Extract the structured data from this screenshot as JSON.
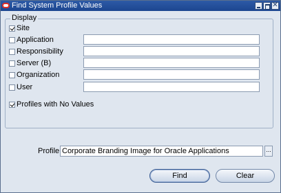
{
  "window": {
    "title": "Find System Profile Values",
    "controls": [
      "minimize-icon",
      "maximize-icon",
      "close-icon"
    ]
  },
  "display_group": {
    "label": "Display",
    "options": [
      {
        "label": "Site",
        "checked": true,
        "has_field": false,
        "field_value": ""
      },
      {
        "label": "Application",
        "checked": false,
        "has_field": true,
        "field_value": ""
      },
      {
        "label": "Responsibility",
        "checked": false,
        "has_field": true,
        "field_value": ""
      },
      {
        "label": "Server (B)",
        "checked": false,
        "has_field": true,
        "field_value": ""
      },
      {
        "label": "Organization",
        "checked": false,
        "has_field": true,
        "field_value": ""
      },
      {
        "label": "User",
        "checked": false,
        "has_field": true,
        "field_value": ""
      }
    ],
    "profiles_no_values": {
      "label": "Profiles with No Values",
      "checked": true
    }
  },
  "profile": {
    "label": "Profile",
    "value": "Corporate Branding Image for Oracle Applications",
    "lov_label": "..."
  },
  "buttons": {
    "find": "Find",
    "clear": "Clear"
  }
}
